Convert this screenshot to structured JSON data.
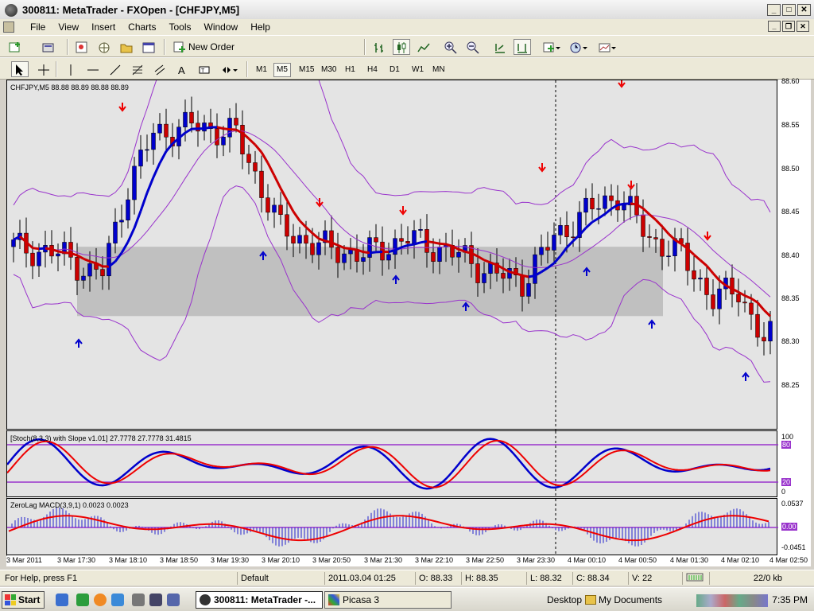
{
  "window": {
    "title": "300811: MetaTrader - FXOpen - [CHFJPY,M5]",
    "controls": [
      "_",
      "□",
      "✕"
    ],
    "mdi_controls": [
      "_",
      "❐",
      "✕"
    ]
  },
  "menu": [
    "File",
    "View",
    "Insert",
    "Charts",
    "Tools",
    "Window",
    "Help"
  ],
  "toolbar": {
    "new_order_label": "New Order",
    "timeframes": [
      "M1",
      "M5",
      "M15",
      "M30",
      "H1",
      "H4",
      "D1",
      "W1",
      "MN"
    ],
    "active_timeframe": "M5",
    "drawing_tools": [
      "cursor",
      "crosshair",
      "vertical-line",
      "horizontal-line",
      "trendline",
      "fibonacci",
      "text",
      "label"
    ]
  },
  "chart": {
    "header": "CHFJPY,M5  88.88 88.89 88.88 88.89",
    "price_labels": [
      "88.60",
      "88.55",
      "88.50",
      "88.45",
      "88.40",
      "88.35",
      "88.30",
      "88.25"
    ],
    "time_labels": [
      "3 Mar 2011",
      "3 Mar 17:30",
      "3 Mar 18:10",
      "3 Mar 18:50",
      "3 Mar 19:30",
      "3 Mar 20:10",
      "3 Mar 20:50",
      "3 Mar 21:30",
      "3 Mar 22:10",
      "3 Mar 22:50",
      "3 Mar 23:30",
      "4 Mar 00:10",
      "4 Mar 00:50",
      "4 Mar 01:30",
      "4 Mar 02:10",
      "4 Mar 02:50"
    ],
    "colors": {
      "bull": "#0000cc",
      "bear": "#cc0000",
      "band": "#9933cc",
      "zone": "#c0c0c0",
      "cyan": "#33dddd"
    }
  },
  "stoch": {
    "title": "[Stoch(8,3,3) with Slope v1.01] 27.7778 27.7778 31.4815",
    "labels": [
      "100",
      "80",
      "20",
      "0"
    ]
  },
  "macd": {
    "title": "ZeroLag MACD(3,9,1) 0.0023 0.0023",
    "labels": [
      "0.0537",
      "0.00",
      "-0.0451"
    ]
  },
  "status": {
    "help": "For Help, press F1",
    "profile": "Default",
    "datetime": "2011.03.04 01:25",
    "open": "O: 88.33",
    "high": "H: 88.35",
    "low": "L: 88.32",
    "close": "C: 88.34",
    "volume": "V: 22",
    "traffic": "22/0 kb"
  },
  "taskbar": {
    "start": "Start",
    "tasks": [
      "300811: MetaTrader -...",
      "Picasa 3"
    ],
    "desktop": "Desktop",
    "my_documents": "My Documents",
    "clock": "7:35 PM"
  }
}
